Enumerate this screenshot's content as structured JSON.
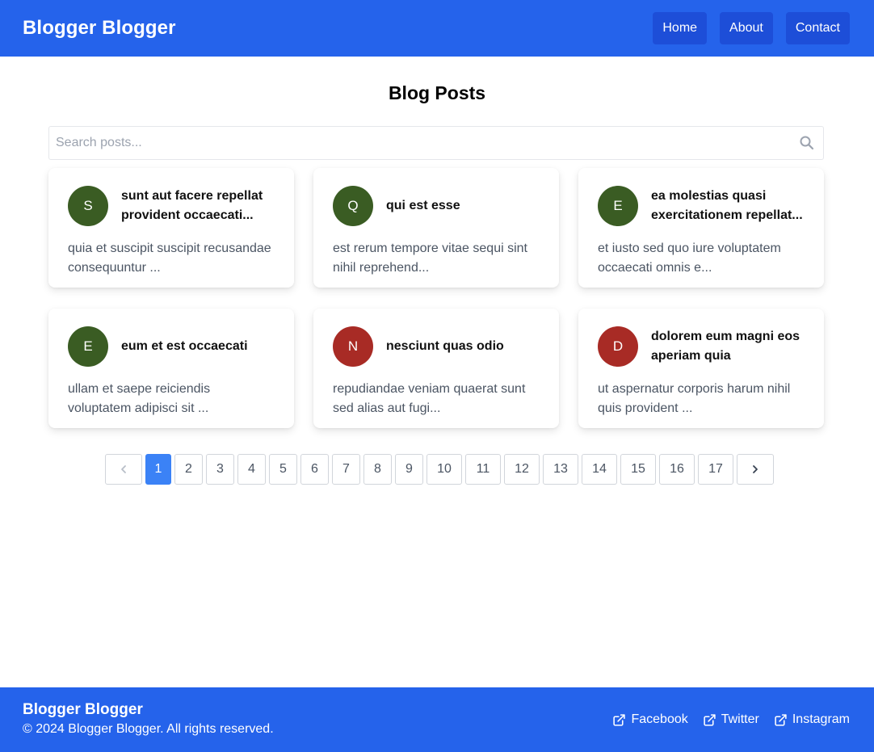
{
  "header": {
    "brand": "Blogger Blogger",
    "nav": [
      "Home",
      "About",
      "Contact"
    ]
  },
  "main": {
    "title": "Blog Posts",
    "search_placeholder": "Search posts..."
  },
  "colors": {
    "primary": "#2563eb",
    "nav_button": "#1d4ed8",
    "active_page": "#3b82f6",
    "avatar_green": "#3a5c23",
    "avatar_red": "#a82b25"
  },
  "posts": [
    {
      "initial": "S",
      "color": "#3a5c23",
      "title": "sunt aut facere repellat provident occaecati...",
      "excerpt": "quia et suscipit suscipit recusandae consequuntur ..."
    },
    {
      "initial": "Q",
      "color": "#3a5c23",
      "title": "qui est esse",
      "excerpt": "est rerum tempore vitae sequi sint nihil reprehend..."
    },
    {
      "initial": "E",
      "color": "#3a5c23",
      "title": "ea molestias quasi exercitationem repellat...",
      "excerpt": "et iusto sed quo iure voluptatem occaecati omnis e..."
    },
    {
      "initial": "E",
      "color": "#3a5c23",
      "title": "eum et est occaecati",
      "excerpt": "ullam et saepe reiciendis voluptatem adipisci sit ..."
    },
    {
      "initial": "N",
      "color": "#a82b25",
      "title": "nesciunt quas odio",
      "excerpt": "repudiandae veniam quaerat sunt sed alias aut fugi..."
    },
    {
      "initial": "D",
      "color": "#a82b25",
      "title": "dolorem eum magni eos aperiam quia",
      "excerpt": "ut aspernatur corporis harum nihil quis provident ..."
    }
  ],
  "pagination": {
    "prev_icon": "chevron-left-icon",
    "next_icon": "chevron-right-icon",
    "current": 1,
    "pages": [
      "1",
      "2",
      "3",
      "4",
      "5",
      "6",
      "7",
      "8",
      "9",
      "10",
      "11",
      "12",
      "13",
      "14",
      "15",
      "16",
      "17"
    ]
  },
  "footer": {
    "brand": "Blogger Blogger",
    "copyright": "© 2024 Blogger Blogger. All rights reserved.",
    "social_icon": "external-link-icon",
    "socials": [
      "Facebook",
      "Twitter",
      "Instagram"
    ]
  }
}
